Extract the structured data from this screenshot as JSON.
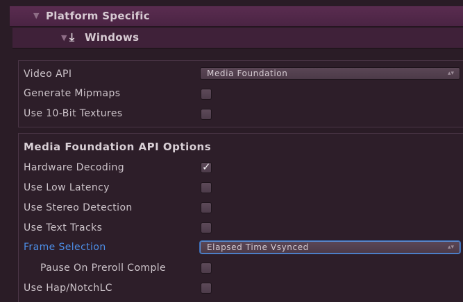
{
  "platform_header": {
    "title": "Platform Specific"
  },
  "windows_header": {
    "title": "Windows"
  },
  "general": {
    "video_api_label": "Video API",
    "video_api_value": "Media Foundation",
    "generate_mipmaps_label": "Generate Mipmaps",
    "generate_mipmaps_checked": false,
    "use_10bit_label": "Use 10-Bit Textures",
    "use_10bit_checked": false
  },
  "mf_options": {
    "title": "Media Foundation API Options",
    "hardware_decoding_label": "Hardware Decoding",
    "hardware_decoding_checked": true,
    "low_latency_label": "Use Low Latency",
    "low_latency_checked": false,
    "stereo_detection_label": "Use Stereo Detection",
    "stereo_detection_checked": false,
    "text_tracks_label": "Use Text Tracks",
    "text_tracks_checked": false,
    "frame_selection_label": "Frame Selection",
    "frame_selection_value": "Elapsed Time Vsynced",
    "pause_preroll_label": "Pause On Preroll Comple",
    "pause_preroll_checked": false,
    "hap_label": "Use Hap/NotchLC",
    "hap_checked": false
  }
}
